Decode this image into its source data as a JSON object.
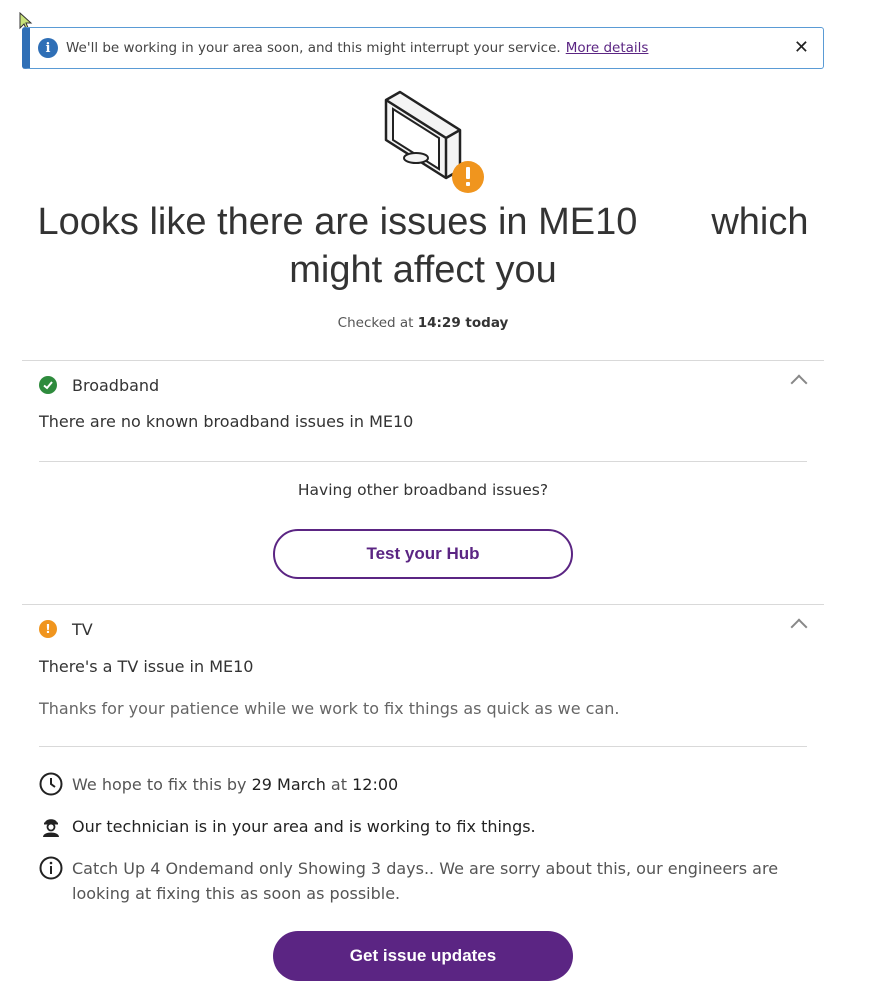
{
  "banner": {
    "message": "We'll be working in your area soon, and this might interrupt your service.",
    "link_label": "More details",
    "close_glyph": "✕"
  },
  "headline": {
    "line1_start": "Looks like there are issues in ME10",
    "line1_end": "which",
    "line2": "might affect you"
  },
  "checked": {
    "prefix": "Checked at",
    "time": "14:29 today"
  },
  "broadband": {
    "title": "Broadband",
    "status_icon": "check-circle-icon",
    "message": "There are no known broadband issues in ME10",
    "other_question": "Having other broadband issues?",
    "test_button": "Test your Hub"
  },
  "tv": {
    "title": "TV",
    "status_icon": "warning-circle-icon",
    "issue": "There's a TV issue in ME10",
    "thanks": "Thanks for your patience while we work to fix things as quick as we can.",
    "fix_prefix": "We hope to fix this by",
    "fix_date": "29 March",
    "fix_at": "at",
    "fix_time": "12:00",
    "technician": "Our technician is in your area and is working to fix things.",
    "info": "Catch Up 4 Ondemand only Showing 3 days.. We are sorry about this, our engineers are looking at fixing this as soon as possible."
  },
  "updates_button": "Get issue updates",
  "colors": {
    "brand_purple": "#5b2583",
    "info_blue": "#2f6fb6",
    "ok_green": "#2e8b3d",
    "warn_orange": "#f0951e"
  }
}
